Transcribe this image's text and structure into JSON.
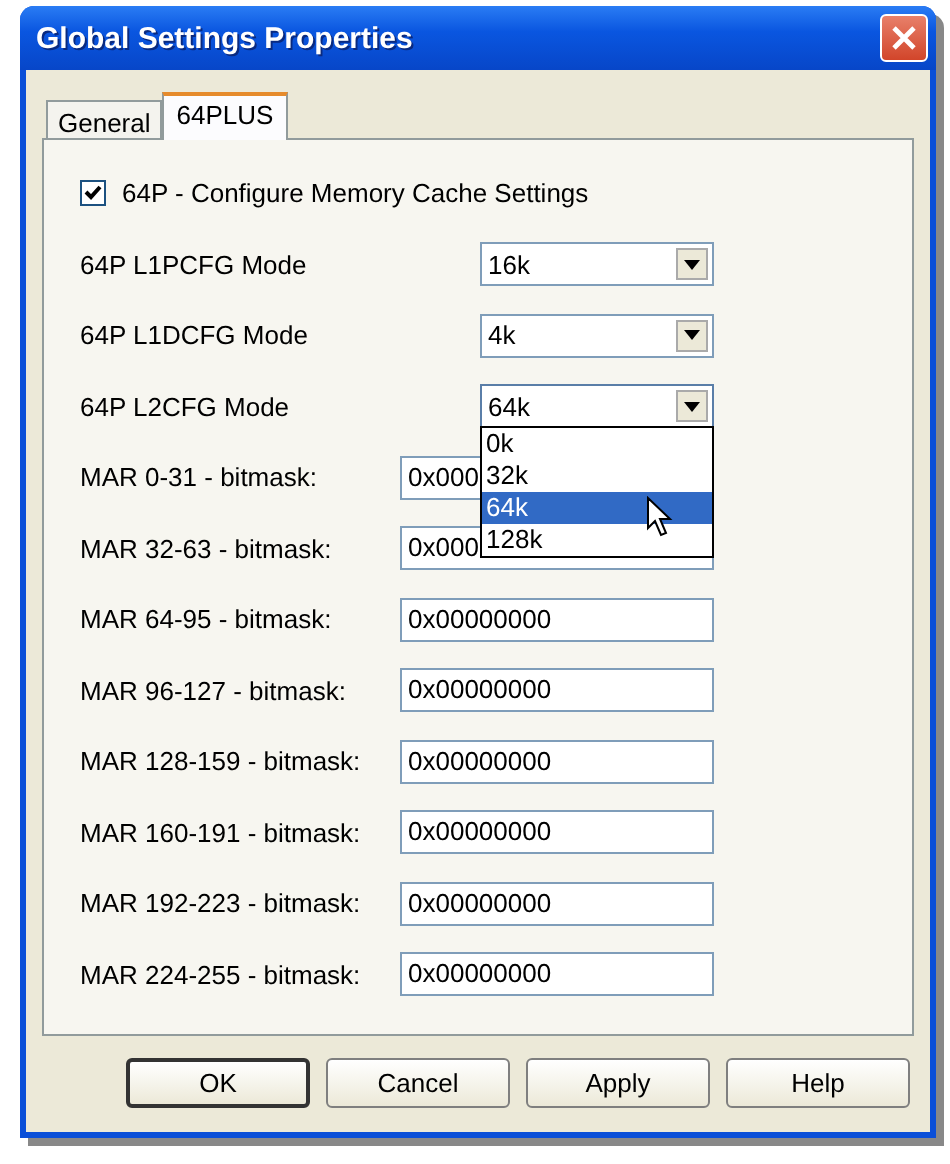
{
  "window": {
    "title": "Global Settings Properties"
  },
  "tabs": [
    {
      "label": "General",
      "selected": false
    },
    {
      "label": "64PLUS",
      "selected": true
    }
  ],
  "checkbox": {
    "label": "64P - Configure Memory Cache Settings",
    "checked": true
  },
  "combos": [
    {
      "label": "64P L1PCFG Mode",
      "value": "16k",
      "open": false
    },
    {
      "label": "64P L1DCFG Mode",
      "value": "4k",
      "open": false
    },
    {
      "label": "64P L2CFG Mode",
      "value": "64k",
      "open": true,
      "options": [
        {
          "label": "0k",
          "selected": false
        },
        {
          "label": "32k",
          "selected": false
        },
        {
          "label": "64k",
          "selected": true
        },
        {
          "label": "128k",
          "selected": false
        }
      ]
    }
  ],
  "bitmasks": [
    {
      "label": "MAR 0-31 - bitmask:",
      "value": "0x000"
    },
    {
      "label": "MAR 32-63 - bitmask:",
      "value": "0x000"
    },
    {
      "label": "MAR 64-95 - bitmask:",
      "value": "0x00000000"
    },
    {
      "label": "MAR 96-127 - bitmask:",
      "value": "0x00000000"
    },
    {
      "label": "MAR 128-159 - bitmask:",
      "value": "0x00000000"
    },
    {
      "label": "MAR 160-191 - bitmask:",
      "value": "0x00000000"
    },
    {
      "label": "MAR 192-223 - bitmask:",
      "value": "0x00000000"
    },
    {
      "label": "MAR 224-255 - bitmask:",
      "value": "0x00000000"
    }
  ],
  "buttons": [
    {
      "label": "OK",
      "default": true
    },
    {
      "label": "Cancel",
      "default": false
    },
    {
      "label": "Apply",
      "default": false
    },
    {
      "label": "Help",
      "default": false
    }
  ]
}
